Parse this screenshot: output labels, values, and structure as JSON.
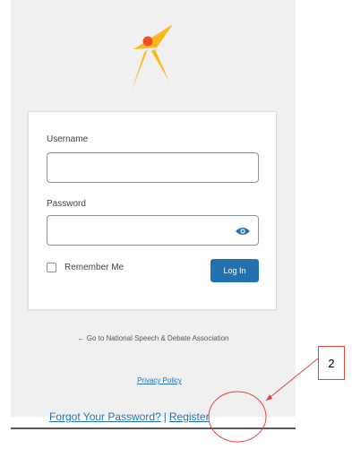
{
  "login": {
    "username_label": "Username",
    "username_value": "",
    "password_label": "Password",
    "password_value": "",
    "remember_label": "Remember Me",
    "login_button": "Log In"
  },
  "footer": {
    "back_link": "← Go to National Speech & Debate Association",
    "privacy_link": "Privacy Policy",
    "forgot_link": "Forgot Your Password?",
    "separator": "|",
    "register_link": "Register"
  },
  "annotation": {
    "callout_number": "2"
  },
  "colors": {
    "accent": "#2271b1",
    "logo_orange": "#f04e23",
    "logo_yellow": "#f9b91c",
    "annotation_red": "#e0443a",
    "panel_bg": "#f0f0f1"
  },
  "icons": {
    "logo": "star-figure-logo",
    "password_toggle": "eye-icon"
  }
}
